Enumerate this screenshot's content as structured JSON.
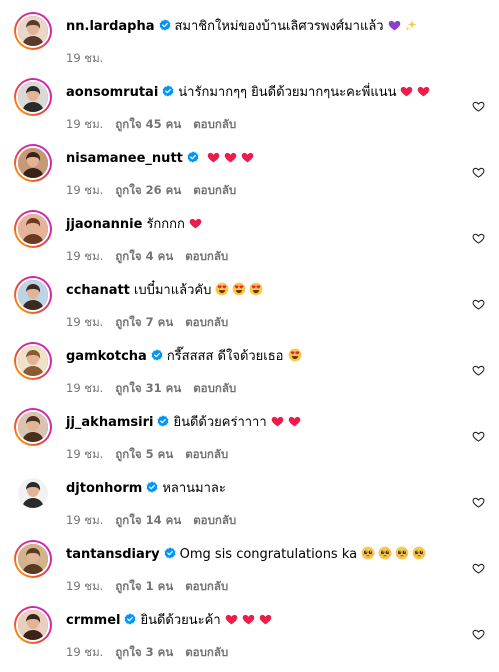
{
  "comments": [
    {
      "username": "nn.lardapha",
      "verified": true,
      "text": "สมาชิกใหม่ของบ้านเลิศวรพงศ์มาแล้ว",
      "emojis": [
        "purple-heart",
        "sparkles"
      ],
      "time": "19 ชม.",
      "likes": "",
      "reply": "",
      "ring": true,
      "has_like_button": false
    },
    {
      "username": "aonsomrutai",
      "verified": true,
      "text": "น่ารักมากๆๆ ยินดีด้วยมากๆนะคะพี่แนน",
      "emojis": [
        "red-heart",
        "red-heart"
      ],
      "time": "19 ชม.",
      "likes": "ถูกใจ 45 คน",
      "reply": "ตอบกลับ",
      "ring": true,
      "has_like_button": true
    },
    {
      "username": "nisamanee_nutt",
      "verified": true,
      "text": "",
      "emojis": [
        "red-heart",
        "red-heart",
        "red-heart"
      ],
      "time": "19 ชม.",
      "likes": "ถูกใจ 26 คน",
      "reply": "ตอบกลับ",
      "ring": true,
      "has_like_button": true
    },
    {
      "username": "jjaonannie",
      "verified": false,
      "text": "รักกกก",
      "emojis": [
        "red-heart"
      ],
      "time": "19 ชม.",
      "likes": "ถูกใจ 4 คน",
      "reply": "ตอบกลับ",
      "ring": true,
      "has_like_button": true
    },
    {
      "username": "cchanatt",
      "verified": false,
      "text": "เบบี๋มาแล้วคับ",
      "emojis": [
        "heart-eyes",
        "heart-eyes",
        "heart-eyes"
      ],
      "time": "19 ชม.",
      "likes": "ถูกใจ 7 คน",
      "reply": "ตอบกลับ",
      "ring": true,
      "has_like_button": true
    },
    {
      "username": "gamkotcha",
      "verified": true,
      "text": "กรี๊สสสส ดีใจด้วยเธอ",
      "emojis": [
        "heart-eyes"
      ],
      "time": "19 ชม.",
      "likes": "ถูกใจ 31 คน",
      "reply": "ตอบกลับ",
      "ring": true,
      "has_like_button": true
    },
    {
      "username": "jj_akhamsiri",
      "verified": true,
      "text": "ยินดีด้วยคร่าาาา",
      "emojis": [
        "red-heart",
        "red-heart"
      ],
      "time": "19 ชม.",
      "likes": "ถูกใจ 5 คน",
      "reply": "ตอบกลับ",
      "ring": true,
      "has_like_button": true
    },
    {
      "username": "djtonhorm",
      "verified": true,
      "text": "หลานมาละ",
      "emojis": [],
      "time": "19 ชม.",
      "likes": "ถูกใจ 14 คน",
      "reply": "ตอบกลับ",
      "ring": false,
      "has_like_button": true
    },
    {
      "username": "tantansdiary",
      "verified": true,
      "text": "Omg sis congratulations ka",
      "emojis": [
        "pleading-face",
        "pleading-face",
        "pleading-face",
        "pleading-face"
      ],
      "time": "19 ชม.",
      "likes": "ถูกใจ 1 คน",
      "reply": "ตอบกลับ",
      "ring": true,
      "has_like_button": true
    },
    {
      "username": "crmmel",
      "verified": true,
      "text": "ยินดีด้วยนะค้า",
      "emojis": [
        "red-heart",
        "red-heart",
        "red-heart"
      ],
      "time": "19 ชม.",
      "likes": "ถูกใจ 3 คน",
      "reply": "ตอบกลับ",
      "ring": true,
      "has_like_button": true
    }
  ],
  "colors": {
    "verified": "#0095f6",
    "meta_text": "#737373",
    "red_heart": "#ed1c4d",
    "purple_heart": "#8a3fd1",
    "ring_start": "#f9c000",
    "ring_end": "#c02fbf"
  }
}
